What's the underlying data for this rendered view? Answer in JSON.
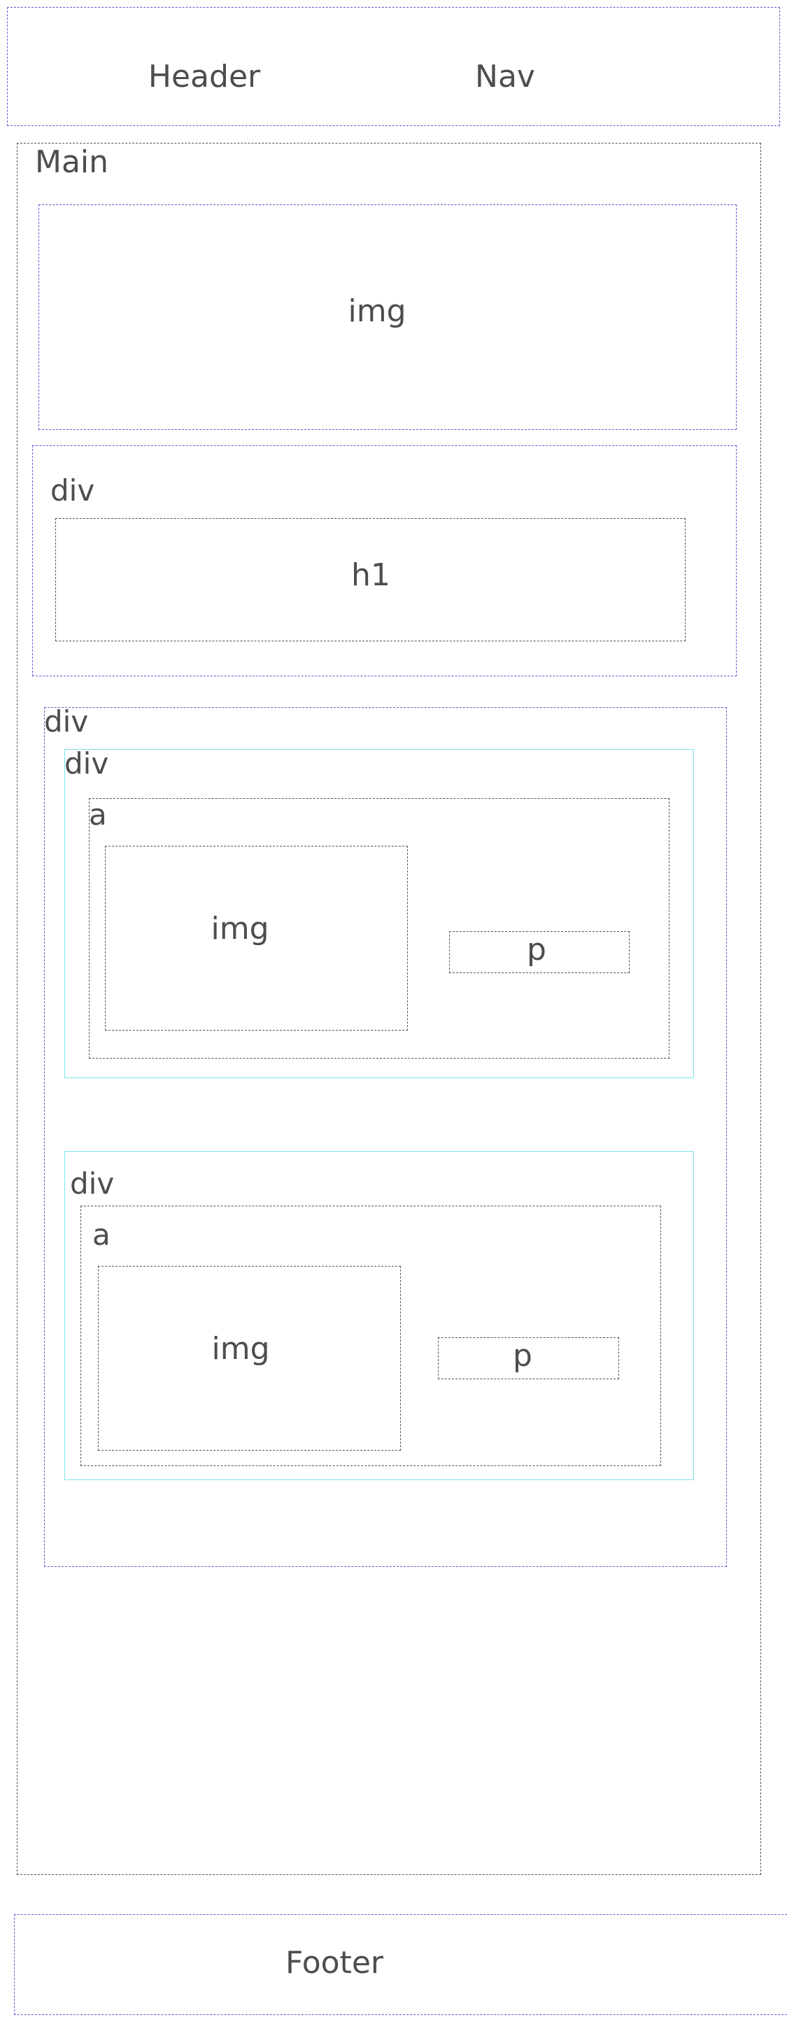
{
  "header": {
    "label": "Header",
    "nav_label": "Nav"
  },
  "main": {
    "label": "Main",
    "hero_img_label": "img",
    "title_section": {
      "div_label": "div",
      "h1_label": "h1"
    },
    "cards_section": {
      "div_label": "div",
      "cards": [
        {
          "div_label": "div",
          "a_label": "a",
          "img_label": "img",
          "p_label": "p"
        },
        {
          "div_label": "div",
          "a_label": "a",
          "img_label": "img",
          "p_label": "p"
        }
      ]
    }
  },
  "footer": {
    "label": "Footer"
  }
}
